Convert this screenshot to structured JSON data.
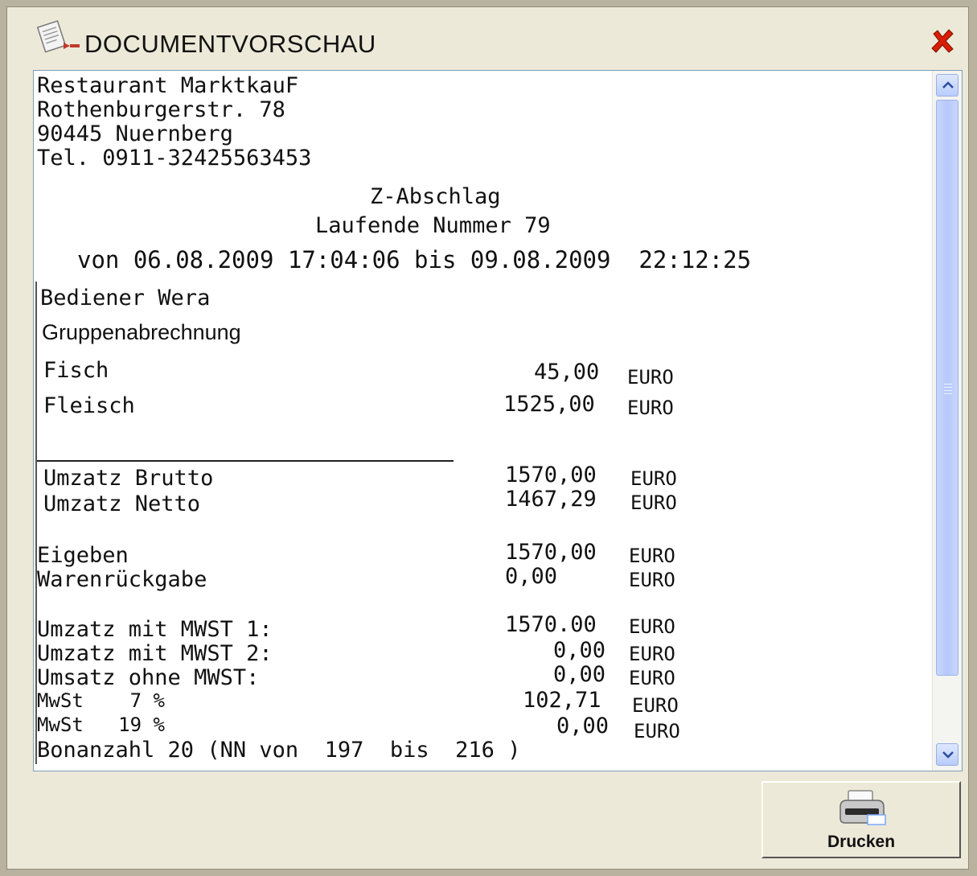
{
  "window": {
    "title": "DOCUMENTVORSCHAU",
    "icons": {
      "app": "document-preview-icon",
      "close": "close-icon"
    }
  },
  "receipt": {
    "header": [
      "Restaurant MarktkauF",
      "Rothenburgerstr. 78",
      "90445 Nuernberg",
      "Tel. 0911-32425563453"
    ],
    "title": "Z-Abschlag",
    "running_number": "Laufende Nummer 79",
    "period": "von 06.08.2009 17:04:06 bis 09.08.2009  22:12:25",
    "operator": "Bediener Wera",
    "section_title": "Gruppenabrechnung",
    "unit": "EURO",
    "groups": [
      {
        "label": "Fisch",
        "amount": "45,00"
      },
      {
        "label": "Fleisch",
        "amount": "1525,00"
      }
    ],
    "totals": [
      {
        "label": "Umzatz Brutto",
        "amount": "1570,00"
      },
      {
        "label": "Umzatz Netto",
        "amount": "1467,29"
      }
    ],
    "entries": [
      {
        "label": "Eigeben",
        "amount": "1570,00"
      },
      {
        "label": "Warenrückgabe",
        "amount": "0,00"
      }
    ],
    "tax": [
      {
        "label": "Umzatz mit MWST 1:",
        "amount": "1570.00"
      },
      {
        "label": "Umzatz mit MWST 2:",
        "amount": "0,00"
      },
      {
        "label": "Umsatz ohne MWST:",
        "amount": "0,00"
      },
      {
        "label": "MwSt    7 %",
        "amount": "102,71"
      },
      {
        "label": "MwSt   19 %",
        "amount": "0,00"
      }
    ],
    "receipt_count": "Bonanzahl 20 (NN von  197  bis  216 )"
  },
  "scrollbar": {
    "up_icon": "scroll-up-icon",
    "down_icon": "scroll-down-icon"
  },
  "print_button": {
    "label": "Drucken",
    "icon": "printer-icon"
  },
  "colors": {
    "window_bg": "#ece9d8",
    "close_red": "#d81e05",
    "scroll_blue": "#b9ccfb"
  }
}
